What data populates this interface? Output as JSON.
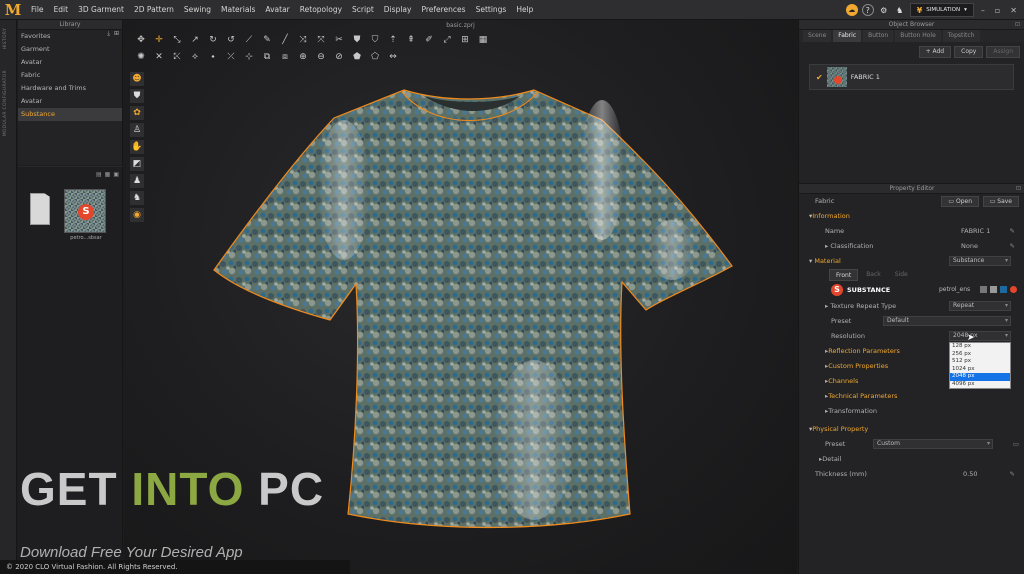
{
  "app": {
    "logo_text": "M"
  },
  "menu": [
    "File",
    "Edit",
    "3D Garment",
    "2D Pattern",
    "Sewing",
    "Materials",
    "Avatar",
    "Retopology",
    "Script",
    "Display",
    "Preferences",
    "Settings",
    "Help"
  ],
  "topright": {
    "simulation_label": "SIMULATION",
    "help": "?"
  },
  "sidebar_tabs": [
    "HISTORY",
    "MODULAR CONFIGURATOR"
  ],
  "library": {
    "title": "Library",
    "items": [
      "Favorites",
      "Garment",
      "Avatar",
      "Fabric",
      "Hardware and Trims",
      "Avatar",
      "Substance"
    ],
    "selected_index": 6
  },
  "browser": {
    "file_label": "petro...sbsar",
    "logo_letter": "S"
  },
  "viewport": {
    "title": "basic.zprj"
  },
  "watermark": {
    "get": "GET ",
    "into": "INTO",
    "pc": " PC",
    "subtitle": "Download Free Your Desired App"
  },
  "copyright": "© 2020 CLO Virtual Fashion. All Rights Reserved.",
  "object_browser": {
    "title": "Object Browser",
    "tabs": [
      "Scene",
      "Fabric",
      "Button",
      "Button Hole",
      "Topstitch"
    ],
    "active_tab": 1,
    "buttons": {
      "add": "+ Add",
      "copy": "Copy",
      "assign": "Assign"
    },
    "fabric_name": "FABRIC 1"
  },
  "property_editor": {
    "title": "Property Editor",
    "header_label": "Fabric",
    "open_label": "Open",
    "save_label": "Save",
    "information": {
      "section": "Information",
      "name_label": "Name",
      "name_value": "FABRIC 1",
      "classification_label": "Classification",
      "classification_value": "None"
    },
    "material": {
      "section": "Material",
      "type_value": "Substance",
      "faces": [
        "Front",
        "Back",
        "Side"
      ],
      "substance_label": "SUBSTANCE",
      "substance_file": "petrol_ens",
      "texture_repeat_label": "Texture Repeat Type",
      "texture_repeat_value": "Repeat",
      "preset_label": "Preset",
      "preset_value": "Default",
      "resolution_label": "Resolution",
      "resolution_value": "2048 px",
      "resolution_options": [
        "128 px",
        "256 px",
        "512 px",
        "1024 px",
        "2048 px",
        "4096 px"
      ],
      "resolution_selected": 4,
      "subsections": [
        "Reflection Parameters",
        "Custom Properties",
        "Channels",
        "Technical Parameters",
        "Transformation"
      ]
    },
    "physical": {
      "section": "Physical Property",
      "preset_label": "Preset",
      "preset_value": "Custom",
      "detail_label": "Detail",
      "thickness_label": "Thickness (mm)",
      "thickness_value": "0.50"
    }
  },
  "colors": {
    "accent": "#f0a830",
    "substance_red": "#e4462c",
    "selection_blue": "#1473e6",
    "watermark_green": "#8ca842"
  }
}
